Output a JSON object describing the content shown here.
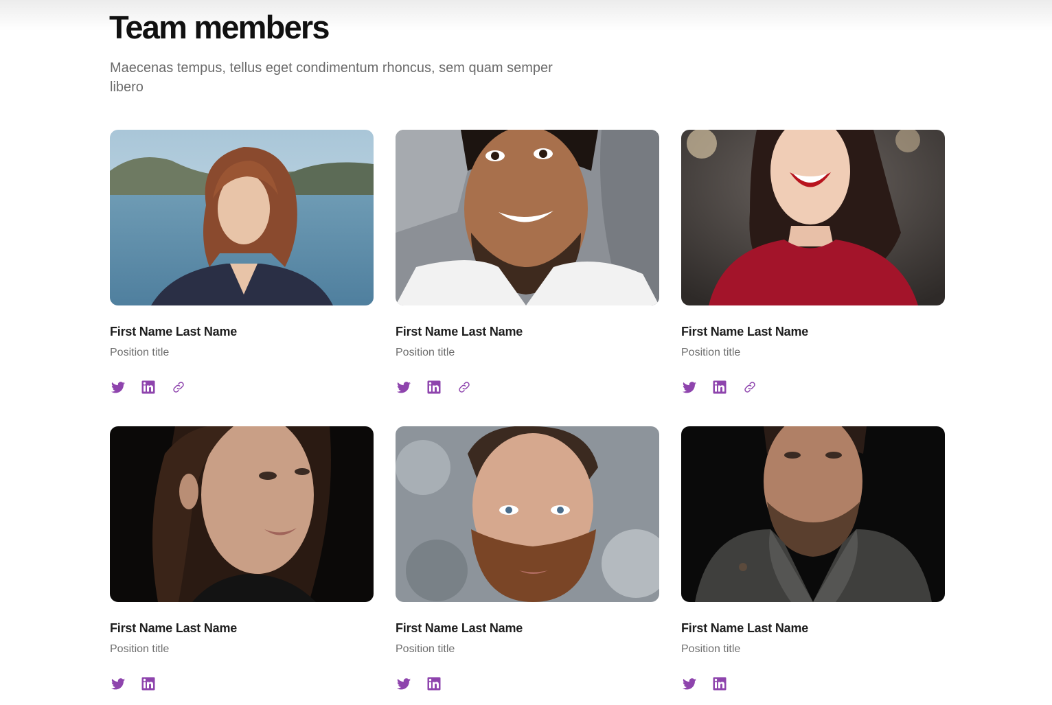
{
  "header": {
    "title": "Team members",
    "subtitle": "Maecenas tempus, tellus eget condimentum rhoncus, sem quam semper libero"
  },
  "colors": {
    "accent": "#8e44ad",
    "title": "#111111",
    "subtitle": "#6b6b6b"
  },
  "team": [
    {
      "name": "First Name Last Name",
      "position": "Position title",
      "photo": "woman-auburn-hair-lake-photo",
      "socials": [
        "twitter-icon",
        "linkedin-icon",
        "link-icon"
      ]
    },
    {
      "name": "First Name Last Name",
      "position": "Position title",
      "photo": "smiling-man-white-shirt-photo",
      "socials": [
        "twitter-icon",
        "linkedin-icon",
        "link-icon"
      ]
    },
    {
      "name": "First Name Last Name",
      "position": "Position title",
      "photo": "laughing-woman-red-sweater-photo",
      "socials": [
        "twitter-icon",
        "linkedin-icon",
        "link-icon"
      ]
    },
    {
      "name": "First Name Last Name",
      "position": "Position title",
      "photo": "woman-dark-background-photo",
      "socials": [
        "twitter-icon",
        "linkedin-icon"
      ]
    },
    {
      "name": "First Name Last Name",
      "position": "Position title",
      "photo": "bearded-man-snowy-background-photo",
      "socials": [
        "twitter-icon",
        "linkedin-icon"
      ]
    },
    {
      "name": "First Name Last Name",
      "position": "Position title",
      "photo": "bearded-man-knit-sweater-photo",
      "socials": [
        "twitter-icon",
        "linkedin-icon"
      ]
    }
  ]
}
